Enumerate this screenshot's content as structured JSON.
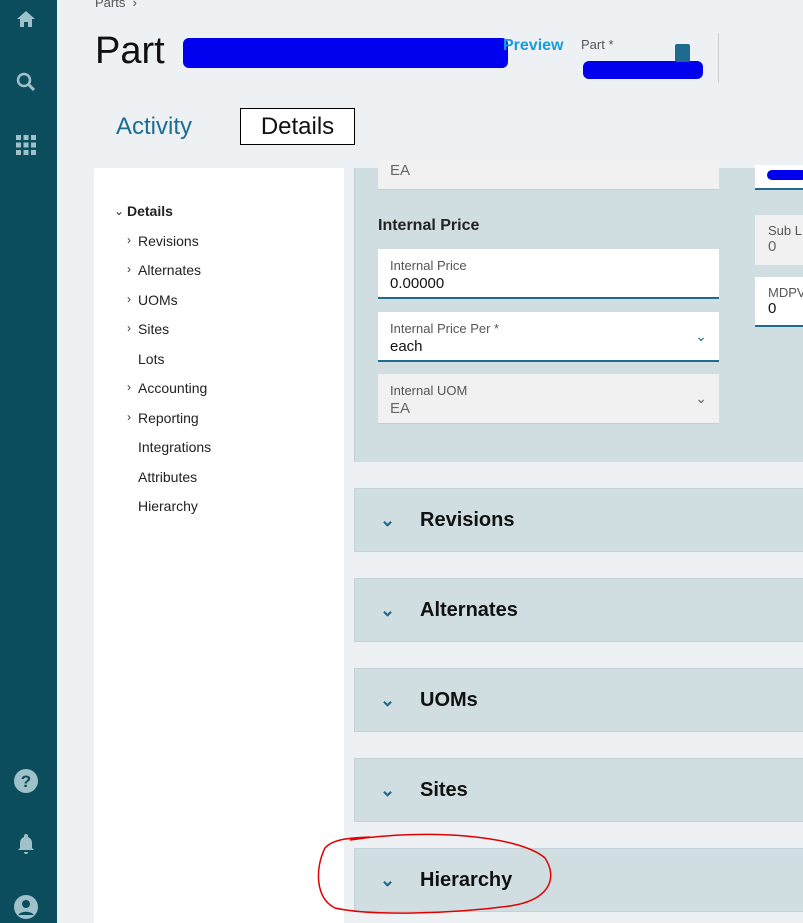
{
  "rail": {
    "icons": [
      "home-icon",
      "search-icon",
      "apps-grid-icon",
      "help-icon",
      "bell-icon",
      "user-icon"
    ]
  },
  "breadcrumb": {
    "item": "Parts",
    "sep": "›"
  },
  "header": {
    "title_prefix": "Part",
    "preview": "Preview",
    "part_label": "Part *"
  },
  "tabs": [
    {
      "label": "Activity"
    },
    {
      "label": "Details"
    }
  ],
  "nav": {
    "root": "Details",
    "items": [
      {
        "label": "Revisions",
        "expandable": true
      },
      {
        "label": "Alternates",
        "expandable": true
      },
      {
        "label": "UOMs",
        "expandable": true
      },
      {
        "label": "Sites",
        "expandable": true
      },
      {
        "label": "Lots",
        "expandable": false
      },
      {
        "label": "Accounting",
        "expandable": true
      },
      {
        "label": "Reporting",
        "expandable": true
      },
      {
        "label": "Integrations",
        "expandable": false
      },
      {
        "label": "Attributes",
        "expandable": false
      },
      {
        "label": "Hierarchy",
        "expandable": false
      }
    ]
  },
  "card": {
    "top_value": "EA",
    "section_title": "Internal Price",
    "internal_price": {
      "label": "Internal Price",
      "value": "0.00000"
    },
    "internal_price_per": {
      "label": "Internal Price Per *",
      "value": "each"
    },
    "internal_uom": {
      "label": "Internal UOM",
      "value": "EA"
    }
  },
  "right": {
    "sub_label": "Sub L",
    "sub_value": "0",
    "mdpv_label": "MDPV",
    "mdpv_value": "0"
  },
  "sections": [
    {
      "title": "Revisions"
    },
    {
      "title": "Alternates"
    },
    {
      "title": "UOMs"
    },
    {
      "title": "Sites"
    },
    {
      "title": "Hierarchy"
    }
  ],
  "colors": {
    "rail": "#0b4d5c",
    "accent": "#1f6b8f",
    "annotation": "#e00000"
  }
}
